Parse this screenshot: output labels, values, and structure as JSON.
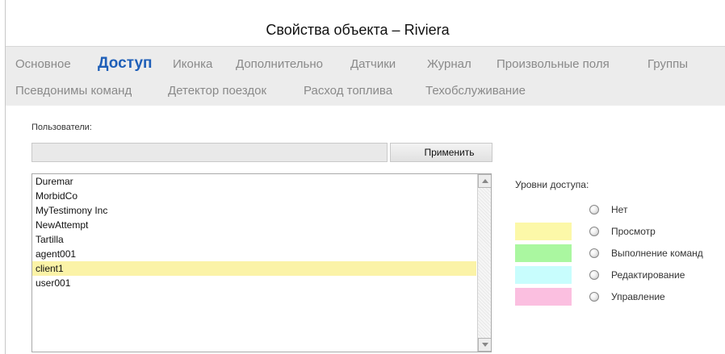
{
  "window": {
    "title": "Свойства объекта – Riviera"
  },
  "tabs": [
    {
      "label": "Основное"
    },
    {
      "label": "Доступ",
      "active": true
    },
    {
      "label": "Иконка"
    },
    {
      "label": "Дополнительно"
    },
    {
      "label": "Датчики"
    },
    {
      "label": "Журнал"
    },
    {
      "label": "Произвольные поля"
    },
    {
      "label": "Группы"
    },
    {
      "label": "Псевдонимы команд"
    },
    {
      "label": "Детектор поездок"
    },
    {
      "label": "Расход топлива"
    },
    {
      "label": "Техобслуживание"
    }
  ],
  "users": {
    "label": "Пользователи:",
    "search_value": "",
    "apply_label": "Применить",
    "items": [
      {
        "name": "Duremar"
      },
      {
        "name": "MorbidCo"
      },
      {
        "name": "MyTestimony Inc"
      },
      {
        "name": "NewAttempt"
      },
      {
        "name": "Tartilla"
      },
      {
        "name": "agent001"
      },
      {
        "name": "client1",
        "selected": true
      },
      {
        "name": "user001"
      }
    ]
  },
  "access_levels": {
    "title": "Уровни доступа:",
    "levels": [
      {
        "label": "Нет",
        "color": ""
      },
      {
        "label": "Просмотр",
        "color": "#fcf8a8"
      },
      {
        "label": "Выполнение команд",
        "color": "#aaf7a0"
      },
      {
        "label": "Редактирование",
        "color": "#c8fdfd"
      },
      {
        "label": "Управление",
        "color": "#fbbfe0"
      }
    ]
  }
}
